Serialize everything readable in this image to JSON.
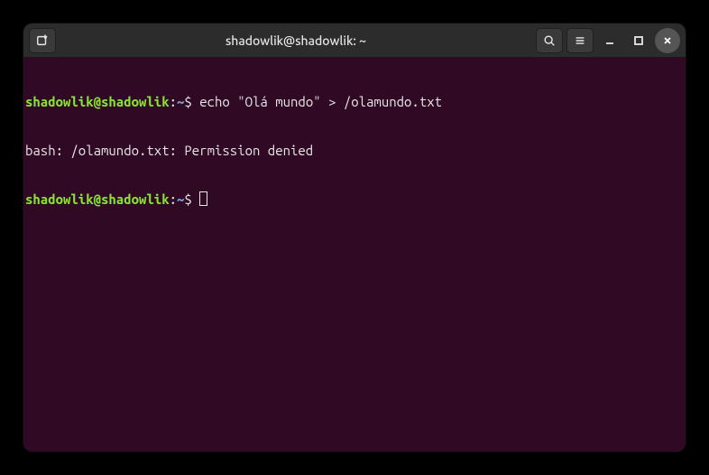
{
  "window": {
    "title": "shadowlik@shadowlik: ~"
  },
  "prompt": {
    "user_host": "shadowlik@shadowlik",
    "separator": ":",
    "path": "~",
    "symbol": "$"
  },
  "lines": {
    "cmd1": "echo \"Olá mundo\" > /olamundo.txt",
    "output1": "bash: /olamundo.txt: Permission denied"
  }
}
